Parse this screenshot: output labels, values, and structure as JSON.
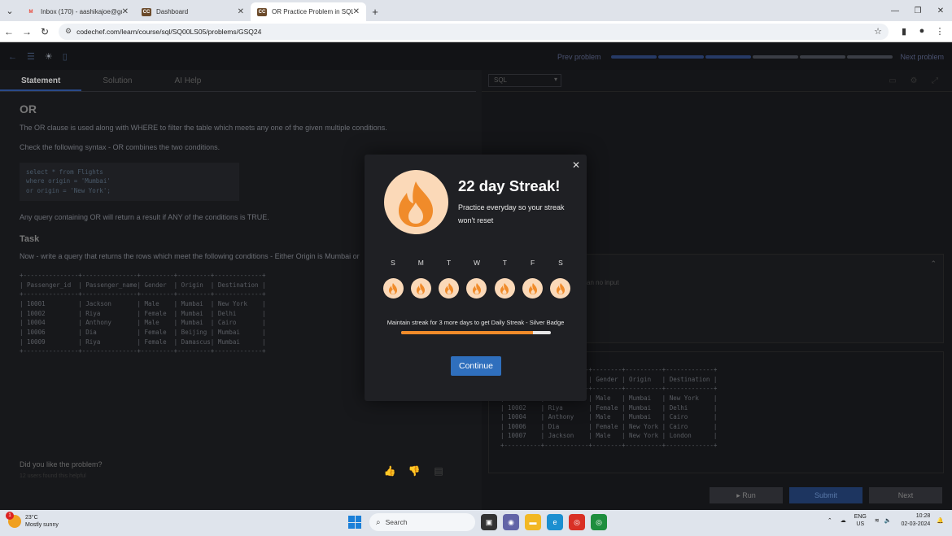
{
  "browser": {
    "tabs": [
      {
        "label": "Inbox (170) - aashikajoe@gmail",
        "favicon": "M",
        "favicon_color": "#ea4335"
      },
      {
        "label": "Dashboard",
        "favicon": "CC",
        "favicon_color": "#6b4a2a"
      },
      {
        "label": "OR Practice Problem in SQL - C",
        "favicon": "CC",
        "favicon_color": "#6b4a2a"
      }
    ],
    "url": "codechef.com/learn/course/sql/SQ00LS05/problems/GSQ24"
  },
  "app": {
    "prev_label": "Prev problem",
    "next_label": "Next problem",
    "subtabs": [
      "Statement",
      "Solution",
      "AI Help"
    ],
    "lang": "SQL",
    "input_placeholder": "an no input",
    "run_label": "▸ Run",
    "submit_label": "Submit",
    "next_btn_label": "Next",
    "feedback_q": "Did you like the problem?",
    "feedback_sub": "12 users found this helpful"
  },
  "statement": {
    "title": "OR",
    "p1": "The OR clause is used along with WHERE to filter the table which meets any one of the given multiple conditions.",
    "p2": "Check the following syntax - OR combines the two conditions.",
    "code": "select * from Flights\nwhere origin = 'Mumbai'\nor origin = 'New York';",
    "p3": "Any query containing OR will return a result if ANY of the conditions is TRUE.",
    "task_title": "Task",
    "task_text": "Now - write a query that returns the rows which meet the following conditions - Either Origin is Mumbai or",
    "table_ascii": "+---------------+---------------+---------+---------+-------------+\n| Passenger_id  | Passenger_name| Gender  | Origin  | Destination |\n+---------------+---------------+---------+---------+-------------+\n| 10001         | Jackson       | Male    | Mumbai  | New York    |\n| 10002         | Riya          | Female  | Mumbai  | Delhi       |\n| 10004         | Anthony       | Male    | Mumbai  | Cairo       |\n| 10006         | Dia           | Female  | Beijing | Mumbai      |\n| 10009         | Riya          | Female  | Damascus| Mumbai      |\n+---------------+---------------+---------+---------+-------------+",
    "output_ascii": "+----------+------------+--------+----------+-------------+\n|          | ger_name   | Gender | Origin   | Destination |\n+----------+------------+--------+----------+-------------+\n| 10001    | Jackson    | Male   | Mumbai   | New York    |\n| 10002    | Riya       | Female | Mumbai   | Delhi       |\n| 10004    | Anthony    | Male   | Mumbai   | Cairo       |\n| 10006    | Dia        | Female | New York | Cairo       |\n| 10007    | Jackson    | Male   | New York | London      |\n+----------+------------+--------+----------+-------------+"
  },
  "modal": {
    "title": "22 day Streak!",
    "subtitle": "Practice everyday so your streak won't reset",
    "days": [
      "S",
      "M",
      "T",
      "W",
      "T",
      "F",
      "S"
    ],
    "maintain_text": "Maintain streak for 3 more days to get Daily Streak - Silver Badge",
    "progress_fraction": 0.88,
    "continue_label": "Continue",
    "accent": "#f08b2a",
    "button_color": "#2f6fbd"
  },
  "taskbar": {
    "weather_temp": "23°C",
    "weather_desc": "Mostly sunny",
    "weather_badge": "1",
    "search_label": "Search",
    "lang1": "ENG",
    "lang2": "US",
    "time": "10:28",
    "date": "02-03-2024"
  }
}
